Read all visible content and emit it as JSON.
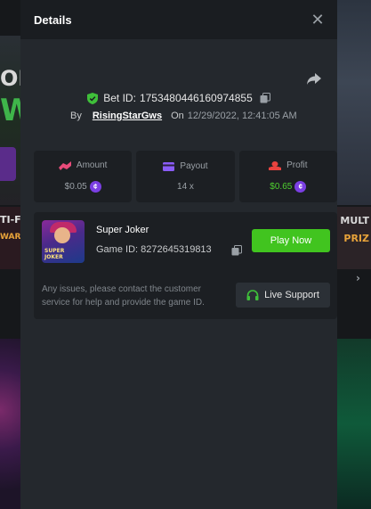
{
  "modal": {
    "title": "Details",
    "close_glyph": "✕"
  },
  "bet": {
    "id_label": "Bet ID:",
    "id_value": "1753480446160974855",
    "by_label": "By",
    "username": "RisingStarGws",
    "on_label": "On",
    "date": "12/29/2022, 12:41:05 AM"
  },
  "stats": {
    "amount": {
      "label": "Amount",
      "value": "$0.05"
    },
    "payout": {
      "label": "Payout",
      "value": "14 x"
    },
    "profit": {
      "label": "Profit",
      "value": "$0.65"
    }
  },
  "game": {
    "name": "Super Joker",
    "id_label": "Game ID:",
    "id_value": "8272645319813",
    "thumb_text_1": "SUPER",
    "thumb_text_2": "JOKER",
    "play_label": "Play Now"
  },
  "support": {
    "text": "Any issues, please contact the customer service for help and provide the game ID.",
    "button_label": "Live Support"
  },
  "background": {
    "left_text_1": "ON",
    "left_text_2": "W",
    "left_text_3": "TI-F",
    "left_text_4": "WARE",
    "right_text_1": "MULT",
    "right_text_2": "PRIZ"
  },
  "colors": {
    "accent_green": "#41c41f",
    "profit_green": "#4ecf2f",
    "coin_purple": "#7b3fe4",
    "amount_pink": "#e84b7a",
    "payout_purple": "#8a5cf6",
    "profit_red": "#e8433f"
  },
  "icons": {
    "share": "share-icon",
    "shield": "shield-check-icon",
    "copy": "copy-icon",
    "amount": "coins-icon",
    "payout": "card-icon",
    "profit": "profit-icon",
    "headset": "headset-icon",
    "coin": "currency-coin-icon"
  }
}
